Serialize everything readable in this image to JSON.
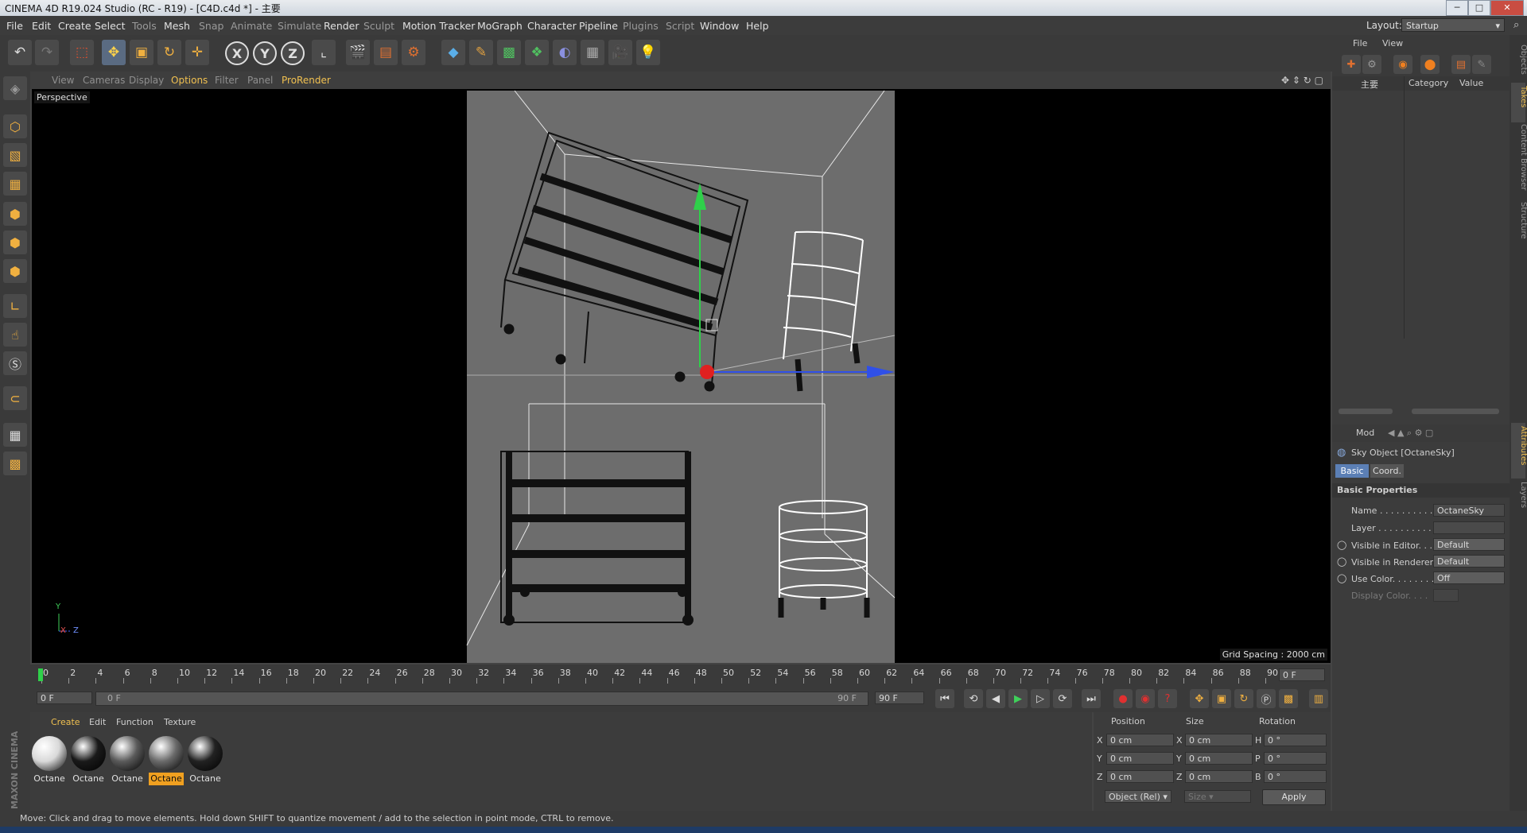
{
  "window": {
    "title": "CINEMA 4D R19.024 Studio (RC - R19) - [C4D.c4d *] - 主要",
    "controls": [
      "─",
      "□",
      "✕"
    ]
  },
  "menubar": {
    "items": [
      "File",
      "Edit",
      "Create",
      "Select",
      "Tools",
      "Mesh",
      "Snap",
      "Animate",
      "Simulate",
      "Render",
      "Sculpt",
      "Motion Tracker",
      "MoGraph",
      "Character",
      "Pipeline",
      "Plugins",
      "Script",
      "Window",
      "Help"
    ],
    "layout_label": "Layout:",
    "layout_value": "Startup"
  },
  "toolbar": {
    "icons": [
      "undo-icon",
      "redo-icon",
      "live-selection-icon",
      "move-icon",
      "scale-icon",
      "rotate-icon",
      "move-all-icon",
      "x-axis-icon",
      "y-axis-icon",
      "z-axis-icon",
      "coordinate-system-icon",
      "render-view-icon",
      "render-picture-viewer-icon",
      "edit-render-settings-icon",
      "cube-icon",
      "pen-icon",
      "subdivision-icon",
      "cloner-icon",
      "deformer-icon",
      "floor-icon",
      "camera-icon",
      "light-icon"
    ],
    "axis_labels": [
      "X",
      "Y",
      "Z"
    ]
  },
  "viewport": {
    "menu": [
      "View",
      "Cameras",
      "Display",
      "Options",
      "Filter",
      "Panel",
      "ProRender"
    ],
    "active_menu": "Options",
    "label": "Perspective",
    "grid_spacing": "Grid Spacing : 2000 cm",
    "axis_y": "Y",
    "axis_x": "X",
    "axis_z": "Z"
  },
  "timeline": {
    "ticks": [
      "0",
      "2",
      "4",
      "6",
      "8",
      "10",
      "12",
      "14",
      "16",
      "18",
      "20",
      "22",
      "24",
      "26",
      "28",
      "30",
      "32",
      "34",
      "36",
      "38",
      "40",
      "42",
      "44",
      "46",
      "48",
      "50",
      "52",
      "54",
      "56",
      "58",
      "60",
      "62",
      "64",
      "66",
      "68",
      "70",
      "72",
      "74",
      "76",
      "78",
      "80",
      "82",
      "84",
      "86",
      "88",
      "90"
    ],
    "current_frame": "0 F",
    "start": "0 F",
    "range_start": "0 F",
    "range_end": "90 F",
    "end": "90 F"
  },
  "materials": {
    "menu": [
      "Create",
      "Edit",
      "Function",
      "Texture"
    ],
    "items": [
      {
        "label": "Octane",
        "color": "#d9d9d9",
        "selected": false
      },
      {
        "label": "Octane",
        "color": "#1a1a1a",
        "selected": false
      },
      {
        "label": "Octane",
        "color": "#5a5a5a",
        "selected": false
      },
      {
        "label": "Octane",
        "color": "#6a6a6a",
        "selected": true
      },
      {
        "label": "Octane",
        "color": "#222222",
        "selected": false
      }
    ]
  },
  "coords": {
    "headers": [
      "Position",
      "Size",
      "Rotation"
    ],
    "rows": [
      {
        "axis": "X",
        "pos": "0 cm",
        "size_axis": "X",
        "size": "0 cm",
        "rot_axis": "H",
        "rot": "0 °"
      },
      {
        "axis": "Y",
        "pos": "0 cm",
        "size_axis": "Y",
        "size": "0 cm",
        "rot_axis": "P",
        "rot": "0 °"
      },
      {
        "axis": "Z",
        "pos": "0 cm",
        "size_axis": "Z",
        "size": "0 cm",
        "rot_axis": "B",
        "rot": "0 °"
      }
    ],
    "mode": "Object (Rel)",
    "size_mode": "Size",
    "apply": "Apply"
  },
  "objects_panel": {
    "menu": [
      "File",
      "View"
    ],
    "col_name": "主要",
    "col_category": "Category",
    "col_value": "Value"
  },
  "attributes": {
    "mode": "Mod",
    "object_title": "Sky Object [OctaneSky]",
    "tabs": [
      "Basic",
      "Coord."
    ],
    "section": "Basic Properties",
    "props": [
      {
        "label": "Name . . . . . . . . . . .",
        "value": "OctaneSky"
      },
      {
        "label": "Layer . . . . . . . . . . .",
        "value": ""
      },
      {
        "label": "Visible in Editor. . .",
        "value": "Default"
      },
      {
        "label": "Visible in Renderer",
        "value": "Default"
      },
      {
        "label": "Use Color. . . . . . . .",
        "value": "Off"
      },
      {
        "label": "Display Color. . . .",
        "value": ""
      }
    ]
  },
  "side_tabs": [
    "Objects",
    "Takes",
    "Content Browser",
    "Structure",
    "Attributes",
    "Layers"
  ],
  "status": {
    "text": "Move: Click and drag to move elements. Hold down SHIFT to quantize movement / add to the selection in point mode, CTRL to remove."
  },
  "logo": {
    "text": "MAXON CINEMA 4D"
  }
}
